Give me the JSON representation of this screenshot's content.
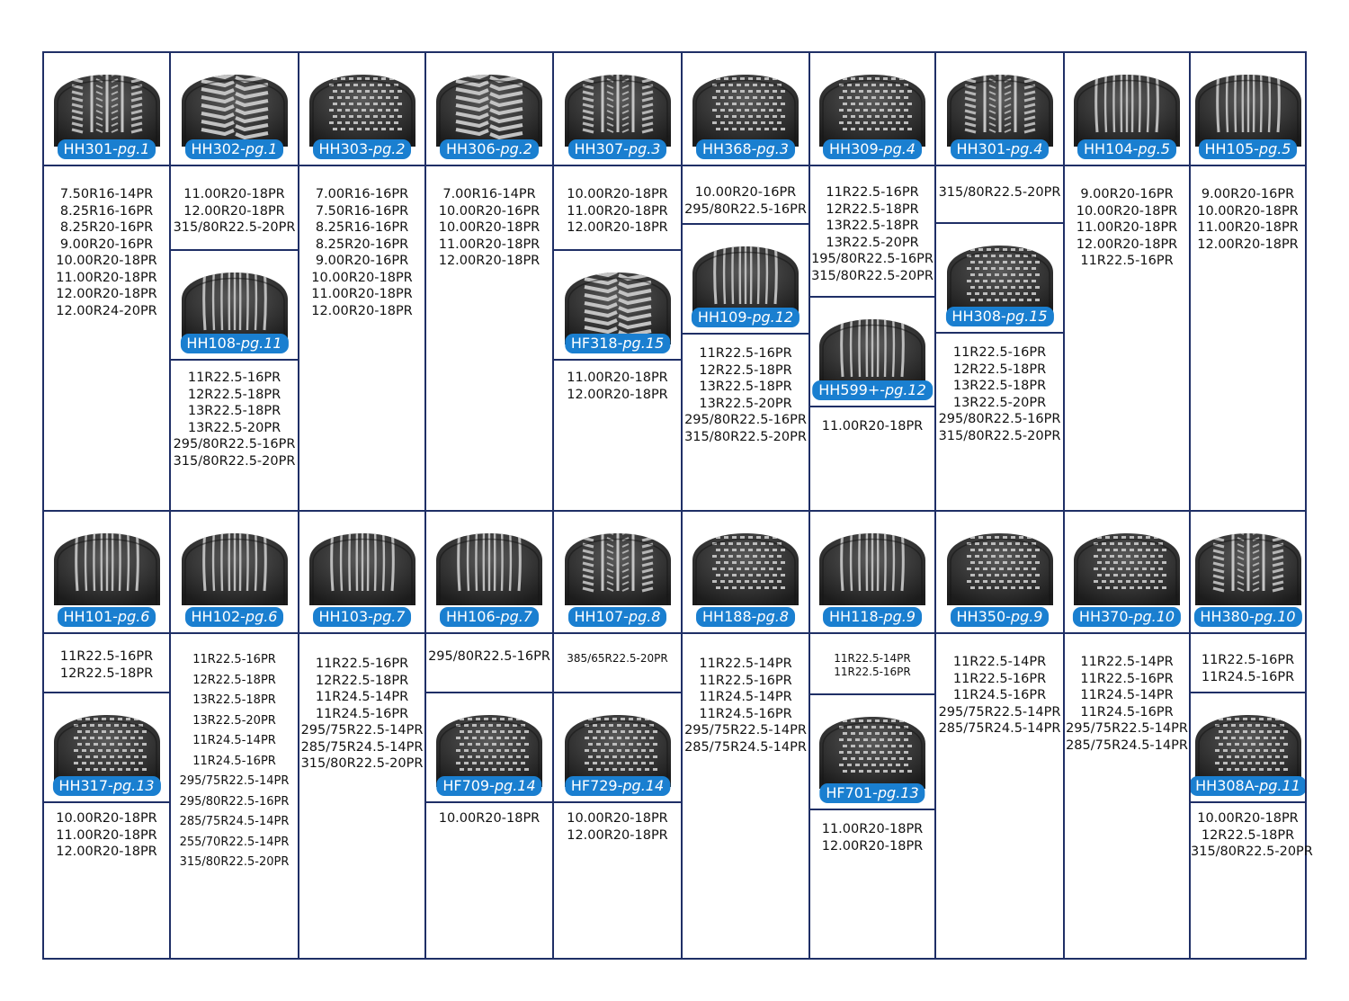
{
  "tires": [
    {
      "id": "t1",
      "model": "HH301",
      "page": "pg.1",
      "tread": "rib-lug"
    },
    {
      "id": "t2",
      "model": "HH302",
      "page": "pg.1",
      "tread": "lug"
    },
    {
      "id": "t3",
      "model": "HH303",
      "page": "pg.2",
      "tread": "block"
    },
    {
      "id": "t4",
      "model": "HH306",
      "page": "pg.2",
      "tread": "lug"
    },
    {
      "id": "t5",
      "model": "HH307",
      "page": "pg.3",
      "tread": "rib-lug"
    },
    {
      "id": "t6",
      "model": "HH368",
      "page": "pg.3",
      "tread": "block"
    },
    {
      "id": "t7",
      "model": "HH309",
      "page": "pg.4",
      "tread": "block"
    },
    {
      "id": "t8",
      "model": "HH301",
      "page": "pg.4",
      "tread": "rib-lug"
    },
    {
      "id": "t9",
      "model": "HH104",
      "page": "pg.5",
      "tread": "rib"
    },
    {
      "id": "t10",
      "model": "HH105",
      "page": "pg.5",
      "tread": "rib"
    },
    {
      "id": "t11",
      "model": "HH108",
      "page": "pg.11",
      "tread": "rib"
    },
    {
      "id": "t12",
      "model": "HF318",
      "page": "pg.15",
      "tread": "lug"
    },
    {
      "id": "t13",
      "model": "HH109",
      "page": "pg.12",
      "tread": "rib"
    },
    {
      "id": "t14",
      "model": "HH599+",
      "page": "pg.12",
      "tread": "rib"
    },
    {
      "id": "t15",
      "model": "HH308",
      "page": "pg.15",
      "tread": "block"
    },
    {
      "id": "t16",
      "model": "HH101",
      "page": "pg.6",
      "tread": "rib"
    },
    {
      "id": "t17",
      "model": "HH102",
      "page": "pg.6",
      "tread": "rib"
    },
    {
      "id": "t18",
      "model": "HH103",
      "page": "pg.7",
      "tread": "rib"
    },
    {
      "id": "t19",
      "model": "HH106",
      "page": "pg.7",
      "tread": "rib"
    },
    {
      "id": "t20",
      "model": "HH107",
      "page": "pg.8",
      "tread": "rib-lug"
    },
    {
      "id": "t21",
      "model": "HH188",
      "page": "pg.8",
      "tread": "block"
    },
    {
      "id": "t22",
      "model": "HH118",
      "page": "pg.9",
      "tread": "rib"
    },
    {
      "id": "t23",
      "model": "HH350",
      "page": "pg.9",
      "tread": "block"
    },
    {
      "id": "t24",
      "model": "HH370",
      "page": "pg.10",
      "tread": "block"
    },
    {
      "id": "t25",
      "model": "HH380",
      "page": "pg.10",
      "tread": "rib-lug"
    },
    {
      "id": "t26",
      "model": "HH317",
      "page": "pg.13",
      "tread": "block"
    },
    {
      "id": "t27",
      "model": "HF709",
      "page": "pg.14",
      "tread": "block"
    },
    {
      "id": "t28",
      "model": "HF729",
      "page": "pg.14",
      "tread": "block"
    },
    {
      "id": "t29",
      "model": "HF701",
      "page": "pg.13",
      "tread": "block"
    },
    {
      "id": "t30",
      "model": "HH308A",
      "page": "pg.11",
      "tread": "block"
    }
  ],
  "size_lists": [
    {
      "id": "s1",
      "text": "7.50R16-14PR\n8.25R16-16PR\n8.25R20-16PR\n9.00R20-16PR\n10.00R20-18PR\n11.00R20-18PR\n12.00R20-18PR\n12.00R24-20PR"
    },
    {
      "id": "s2",
      "text": "11.00R20-18PR\n12.00R20-18PR\n315/80R22.5-20PR"
    },
    {
      "id": "s3",
      "text": "7.00R16-16PR\n7.50R16-16PR\n8.25R16-16PR\n8.25R20-16PR\n9.00R20-16PR\n10.00R20-18PR\n11.00R20-18PR\n12.00R20-18PR"
    },
    {
      "id": "s4",
      "text": "7.00R16-14PR\n10.00R20-16PR\n10.00R20-18PR\n11.00R20-18PR\n12.00R20-18PR"
    },
    {
      "id": "s5",
      "text": "10.00R20-18PR\n11.00R20-18PR\n12.00R20-18PR"
    },
    {
      "id": "s6",
      "text": "10.00R20-16PR\n295/80R22.5-16PR"
    },
    {
      "id": "s7",
      "text": "11R22.5-16PR\n12R22.5-18PR\n13R22.5-18PR\n13R22.5-20PR\n195/80R22.5-16PR\n315/80R22.5-20PR"
    },
    {
      "id": "s8",
      "text": "315/80R22.5-20PR"
    },
    {
      "id": "s9",
      "text": "9.00R20-16PR\n10.00R20-18PR\n11.00R20-18PR\n12.00R20-18PR\n11R22.5-16PR"
    },
    {
      "id": "s10",
      "text": "9.00R20-16PR\n10.00R20-18PR\n11.00R20-18PR\n12.00R20-18PR"
    },
    {
      "id": "s11",
      "text": "11R22.5-16PR\n12R22.5-18PR\n13R22.5-18PR\n13R22.5-20PR\n295/80R22.5-16PR\n315/80R22.5-20PR"
    },
    {
      "id": "s12",
      "text": "11.00R20-18PR\n12.00R20-18PR"
    },
    {
      "id": "s13",
      "text": "11R22.5-16PR\n12R22.5-18PR\n13R22.5-18PR\n13R22.5-20PR\n295/80R22.5-16PR\n315/80R22.5-20PR"
    },
    {
      "id": "s14",
      "text": "11.00R20-18PR"
    },
    {
      "id": "s15",
      "text": "11R22.5-16PR\n12R22.5-18PR\n13R22.5-18PR\n13R22.5-20PR\n295/80R22.5-16PR\n315/80R22.5-20PR"
    },
    {
      "id": "s16",
      "text": "11R22.5-16PR\n12R22.5-18PR"
    },
    {
      "id": "s17",
      "text": "11R22.5-16PR\n12R22.5-18PR\n13R22.5-18PR\n13R22.5-20PR\n11R24.5-14PR\n11R24.5-16PR\n295/75R22.5-14PR\n295/80R22.5-16PR\n285/75R24.5-14PR\n255/70R22.5-14PR\n315/80R22.5-20PR"
    },
    {
      "id": "s18",
      "text": "11R22.5-16PR\n12R22.5-18PR\n11R24.5-14PR\n11R24.5-16PR\n295/75R22.5-14PR\n285/75R24.5-14PR\n315/80R22.5-20PR"
    },
    {
      "id": "s19",
      "text": "295/80R22.5-16PR"
    },
    {
      "id": "s20",
      "text": "385/65R22.5-20PR"
    },
    {
      "id": "s21",
      "text": "11R22.5-14PR\n11R22.5-16PR\n11R24.5-14PR\n11R24.5-16PR\n295/75R22.5-14PR\n285/75R24.5-14PR"
    },
    {
      "id": "s22",
      "text": "11R22.5-14PR\n11R22.5-16PR"
    },
    {
      "id": "s23",
      "text": "11R22.5-14PR\n11R22.5-16PR\n11R24.5-16PR\n295/75R22.5-14PR\n285/75R24.5-14PR"
    },
    {
      "id": "s24",
      "text": "11R22.5-14PR\n11R22.5-16PR\n11R24.5-14PR\n11R24.5-16PR\n295/75R22.5-14PR\n285/75R24.5-14PR"
    },
    {
      "id": "s25",
      "text": "11R22.5-16PR\n11R24.5-16PR"
    },
    {
      "id": "s26",
      "text": "10.00R20-18PR\n11.00R20-18PR\n12.00R20-18PR"
    },
    {
      "id": "s27",
      "text": "10.00R20-18PR"
    },
    {
      "id": "s28",
      "text": "10.00R20-18PR\n12.00R20-18PR"
    },
    {
      "id": "s29",
      "text": "11.00R20-18PR\n12.00R20-18PR"
    },
    {
      "id": "s30",
      "text": "10.00R20-18PR\n12R22.5-18PR\n315/80R22.5-20PR"
    }
  ]
}
